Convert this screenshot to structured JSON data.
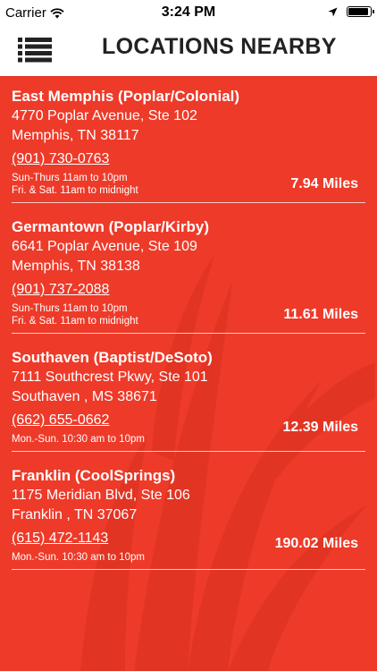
{
  "status_bar": {
    "carrier": "Carrier",
    "time": "3:24 PM"
  },
  "header": {
    "title": "LOCATIONS NEARBY"
  },
  "locations": [
    {
      "name": "East Memphis (Poplar/Colonial)",
      "address1": "4770 Poplar Avenue, Ste 102",
      "address2": "Memphis, TN 38117",
      "phone": "(901) 730-0763",
      "hours1": "Sun-Thurs 11am to 10pm",
      "hours2": "Fri. & Sat. 11am to midnight",
      "distance": "7.94 Miles"
    },
    {
      "name": "Germantown (Poplar/Kirby)",
      "address1": "6641 Poplar Avenue, Ste 109",
      "address2": "Memphis, TN 38138",
      "phone": "(901) 737-2088",
      "hours1": "Sun-Thurs 11am to 10pm",
      "hours2": "Fri. & Sat. 11am to midnight",
      "distance": "11.61 Miles"
    },
    {
      "name": "Southaven (Baptist/DeSoto)",
      "address1": "7111 Southcrest Pkwy, Ste 101",
      "address2": "Southaven , MS 38671",
      "phone": "(662) 655-0662",
      "hours1": "Mon.-Sun. 10:30 am to 10pm",
      "distance": "12.39 Miles"
    },
    {
      "name": "Franklin (CoolSprings)",
      "address1": "1175 Meridian Blvd, Ste 106",
      "address2": "Franklin , TN 37067",
      "phone": "(615) 472-1143",
      "hours1": "Mon.-Sun. 10:30 am to 10pm",
      "distance": "190.02 Miles"
    }
  ],
  "colors": {
    "background": "#ee3a29",
    "header_bg": "#ffffff",
    "text": "#ffffff"
  }
}
